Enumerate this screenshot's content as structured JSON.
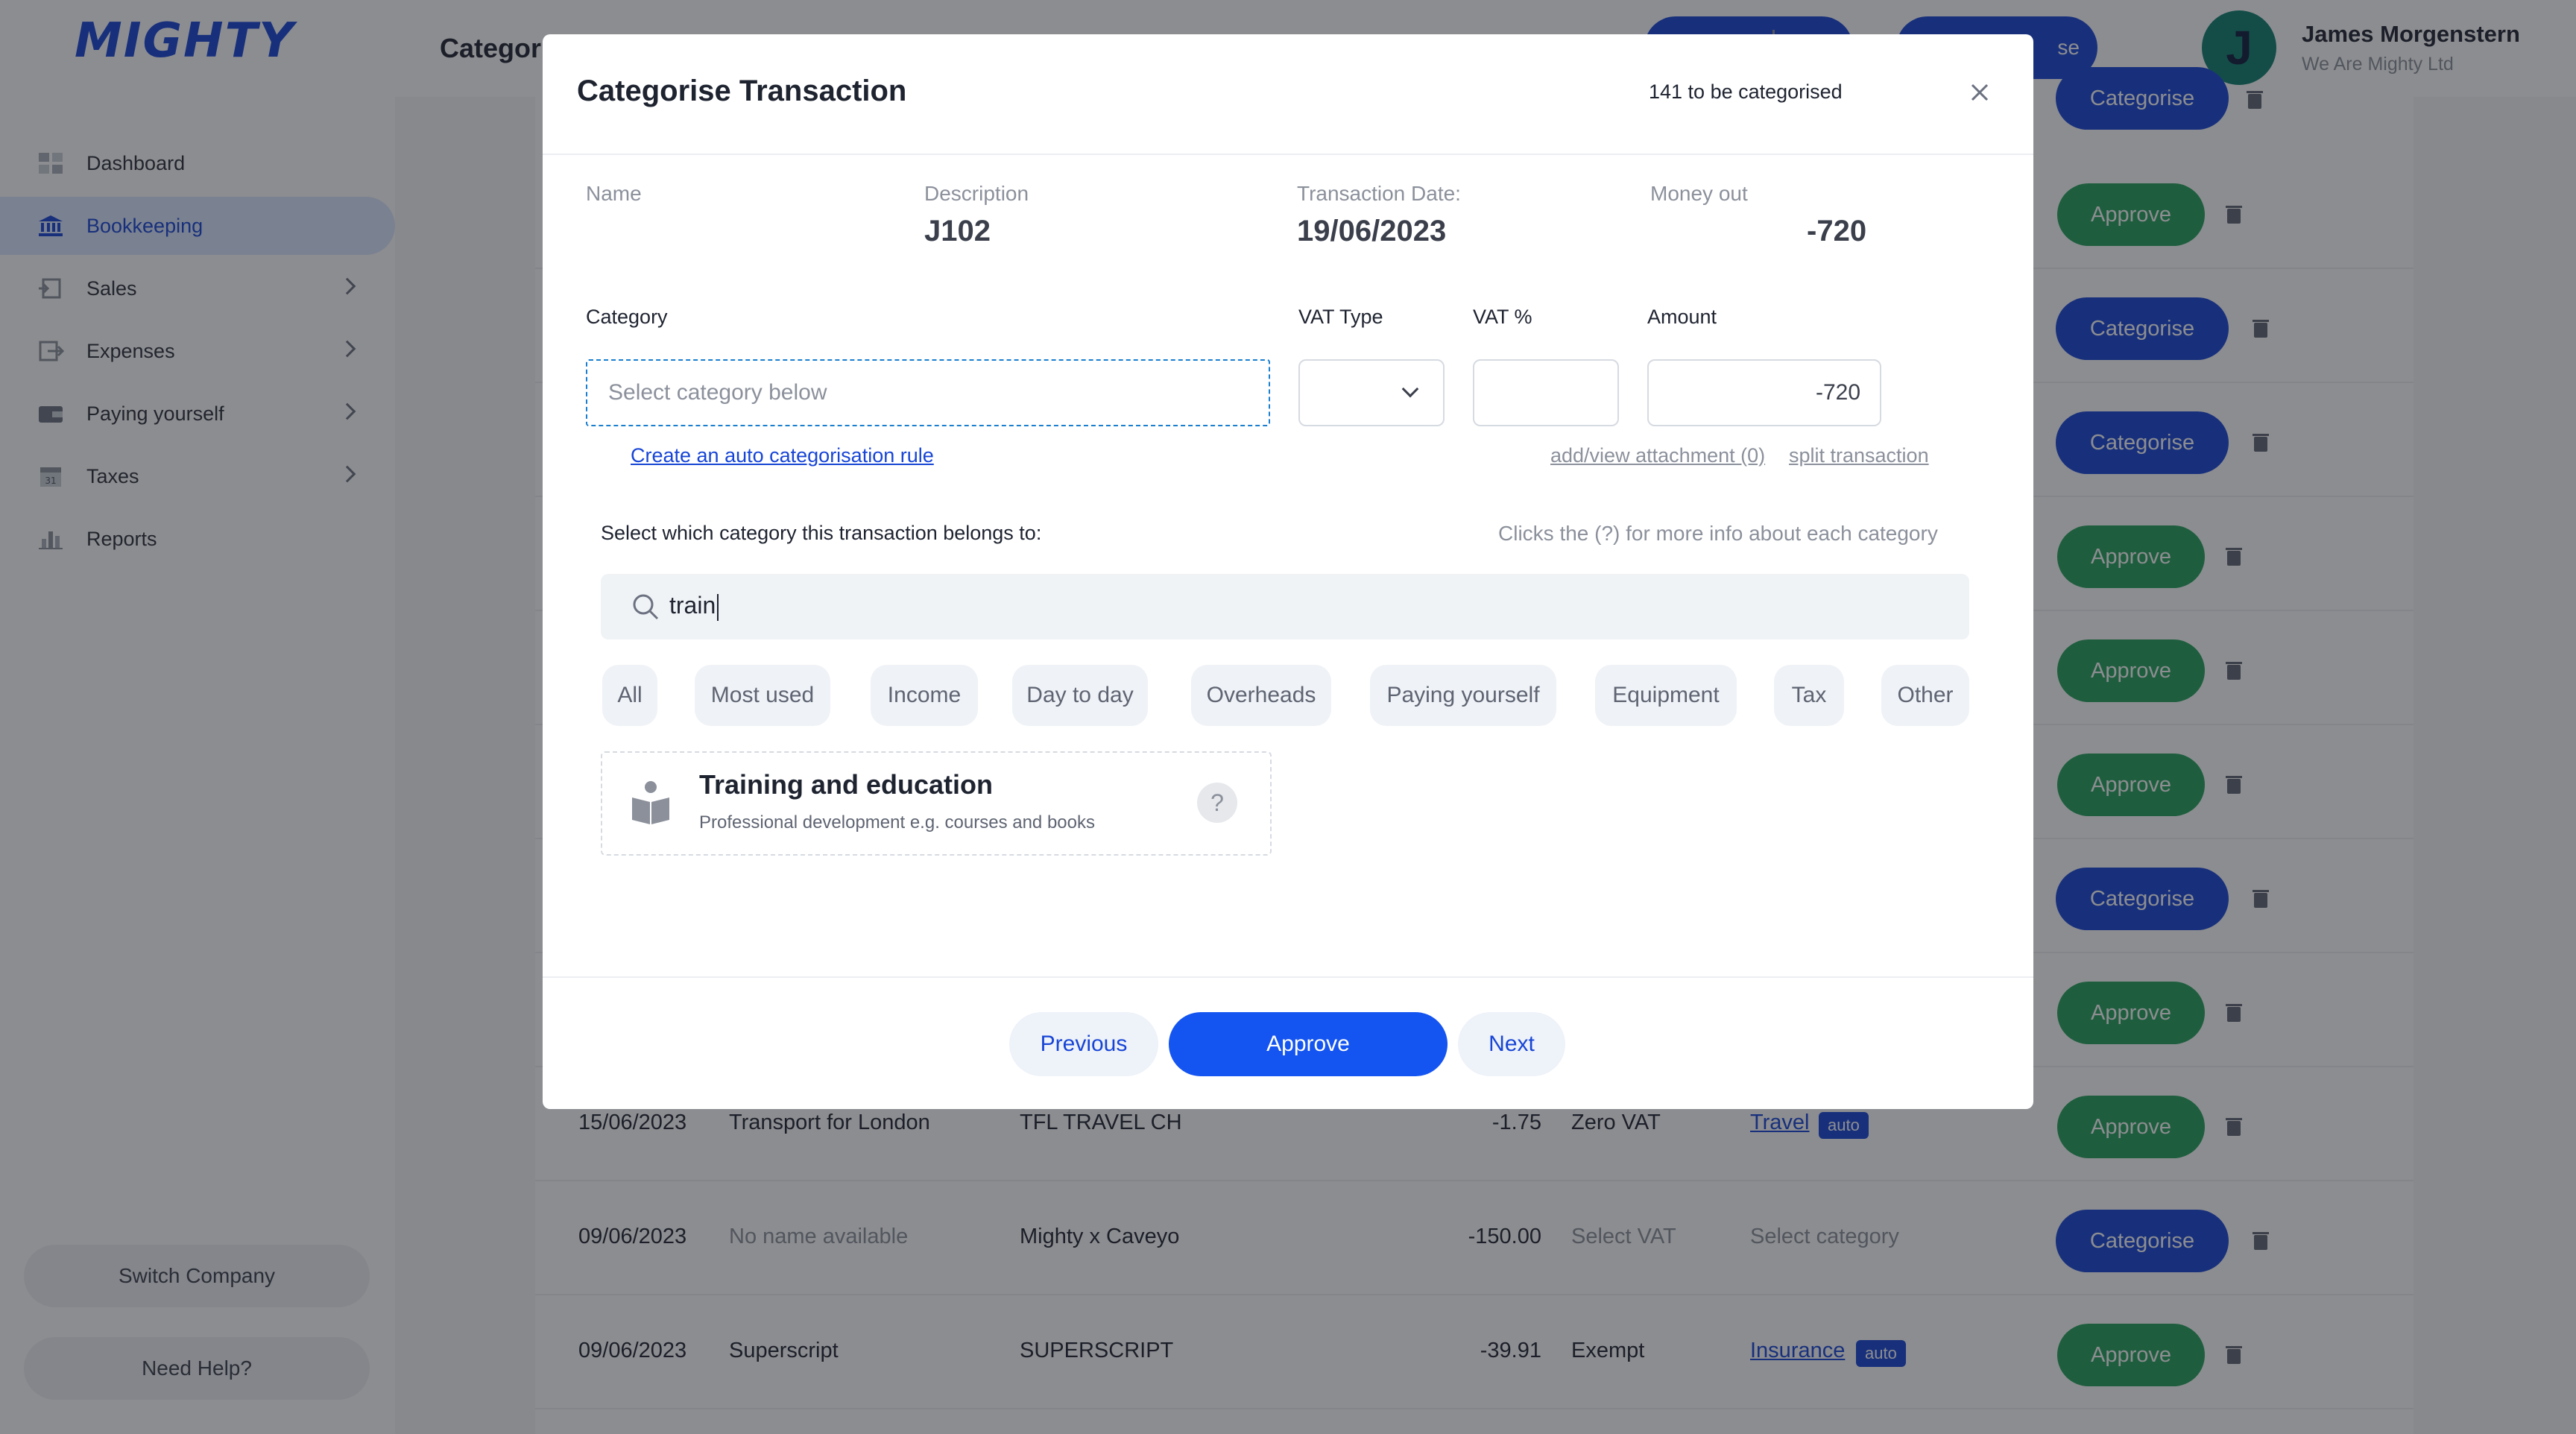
{
  "brand": {
    "logo": "MIGHTY",
    "accent": "#1745d6",
    "approve_green": "#22a05a"
  },
  "sidebar": {
    "items": [
      {
        "label": "Dashboard",
        "icon": "dashboard-icon",
        "active": false,
        "chevron": false
      },
      {
        "label": "Bookkeeping",
        "icon": "bank-icon",
        "active": true,
        "chevron": false
      },
      {
        "label": "Sales",
        "icon": "sales-icon",
        "active": false,
        "chevron": true
      },
      {
        "label": "Expenses",
        "icon": "expenses-icon",
        "active": false,
        "chevron": true
      },
      {
        "label": "Paying yourself",
        "icon": "wallet-icon",
        "active": false,
        "chevron": true
      },
      {
        "label": "Taxes",
        "icon": "calendar-icon",
        "active": false,
        "chevron": true
      },
      {
        "label": "Reports",
        "icon": "bar-chart-icon",
        "active": false,
        "chevron": false
      }
    ],
    "switch_company": "Switch Company",
    "need_help": "Need Help?"
  },
  "header": {
    "title": "Categor",
    "btn2_label": "se",
    "user_initial": "J",
    "user_name": "James Morgenstern",
    "user_company": "We Are Mighty Ltd"
  },
  "table": {
    "approve_label": "Approve",
    "categorise_label": "Categorise",
    "row_actions": [
      "Categorise",
      "Approve",
      "Categorise",
      "Categorise",
      "Approve",
      "Approve",
      "Approve",
      "Categorise",
      "Approve"
    ],
    "rows": [
      {
        "date": "15/06/2023",
        "name": "Transport for London",
        "description": "TFL TRAVEL CH",
        "amount": "-1.75",
        "vat": "Zero VAT",
        "category": "Travel",
        "auto": "auto",
        "action": "Approve"
      },
      {
        "date": "09/06/2023",
        "name": "No name available",
        "description": "Mighty x Caveyo",
        "amount": "-150.00",
        "vat": "Select VAT",
        "category": "Select category",
        "auto": "",
        "action": "Categorise"
      },
      {
        "date": "09/06/2023",
        "name": "Superscript",
        "description": "SUPERSCRIPT",
        "amount": "-39.91",
        "vat": "Exempt",
        "category": "Insurance",
        "auto": "auto",
        "action": "Approve"
      }
    ]
  },
  "modal": {
    "title": "Categorise Transaction",
    "count_text": "141 to be categorised",
    "name_label": "Name",
    "description_label": "Description",
    "description_value": "J102",
    "date_label": "Transaction Date:",
    "date_value": "19/06/2023",
    "money_label": "Money out",
    "money_value": "-720",
    "category_label": "Category",
    "category_placeholder": "Select category below",
    "vat_type_label": "VAT Type",
    "vat_pct_label": "VAT %",
    "amount_label": "Amount",
    "amount_value": "-720",
    "auto_rule_link": "Create an auto categorisation rule",
    "attachment_link": "add/view attachment (0)",
    "split_link": "split transaction",
    "select_prompt": "Select which category this transaction belongs to:",
    "help_hint": "Clicks the (?) for more info about each category",
    "search_value": "train",
    "chips": [
      "All",
      "Most used",
      "Income",
      "Day to day",
      "Overheads",
      "Paying yourself",
      "Equipment",
      "Tax",
      "Other"
    ],
    "result": {
      "icon": "book-reader-icon",
      "title": "Training and education",
      "description": "Professional development e.g. courses and books",
      "help": "?"
    },
    "previous_label": "Previous",
    "approve_label": "Approve",
    "next_label": "Next"
  }
}
